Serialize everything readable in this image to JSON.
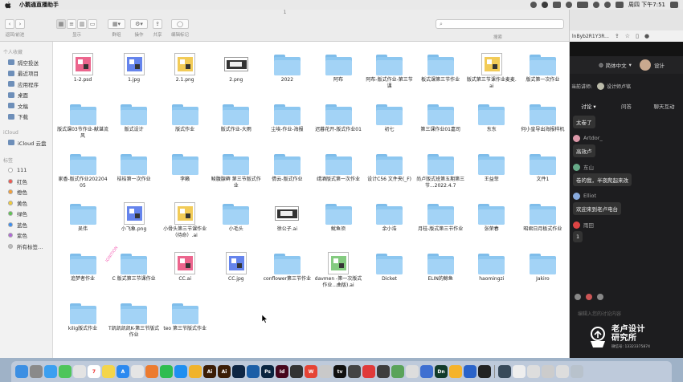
{
  "menubar": {
    "app_name": "小鹅通直播助手",
    "clock": "周四 下午7:51"
  },
  "finder": {
    "title": "1",
    "toolbar": {
      "nav_label": "返回/前进",
      "view_label": "显示",
      "group_label": "群组",
      "action_label": "操作",
      "share_label": "共享",
      "tags_label": "编辑标记",
      "search_label": "搜索"
    },
    "sidebar": {
      "favorites_head": "个人收藏",
      "favorites": [
        {
          "label": "隔空投送",
          "icon": "airdrop-icon"
        },
        {
          "label": "最近项目",
          "icon": "clock-icon"
        },
        {
          "label": "应用程序",
          "icon": "apps-icon"
        },
        {
          "label": "桌面",
          "icon": "desktop-icon"
        },
        {
          "label": "文稿",
          "icon": "document-icon"
        },
        {
          "label": "下载",
          "icon": "download-icon"
        }
      ],
      "icloud_head": "iCloud",
      "icloud": [
        {
          "label": "iCloud 云盘",
          "icon": "cloud-icon"
        }
      ],
      "tags_head": "标签",
      "tags": [
        {
          "label": "111",
          "color": "#ffffff"
        },
        {
          "label": "红色",
          "color": "#ee5a52"
        },
        {
          "label": "橙色",
          "color": "#f4a03a"
        },
        {
          "label": "黄色",
          "color": "#f1cc3b"
        },
        {
          "label": "绿色",
          "color": "#5fc454"
        },
        {
          "label": "蓝色",
          "color": "#3d8ff0"
        },
        {
          "label": "紫色",
          "color": "#b06ad6"
        },
        {
          "label": "所有标签…",
          "color": "#bdbdbd"
        }
      ]
    },
    "files": [
      {
        "name": "1-2.psd",
        "kind": "image"
      },
      {
        "name": "1.jpg",
        "kind": "image"
      },
      {
        "name": "2.1.png",
        "kind": "image"
      },
      {
        "name": "2.png",
        "kind": "wide"
      },
      {
        "name": "2022",
        "kind": "folder"
      },
      {
        "name": "阿布",
        "kind": "folder"
      },
      {
        "name": "阿布-版式作业-第三节课",
        "kind": "folder"
      },
      {
        "name": "板式课第三节作业",
        "kind": "folder"
      },
      {
        "name": "版式第三节课作业麦麦.ai",
        "kind": "image"
      },
      {
        "name": "版式第一次作业",
        "kind": "folder"
      },
      {
        "name": "版式课03节作业-献谌流风",
        "kind": "folder"
      },
      {
        "name": "版式设计",
        "kind": "folder"
      },
      {
        "name": "版式作业",
        "kind": "folder"
      },
      {
        "name": "版式作业-大雨",
        "kind": "folder"
      },
      {
        "name": "尘埃-作业-海报",
        "kind": "folder"
      },
      {
        "name": "迟暮花开-版式作业01",
        "kind": "folder"
      },
      {
        "name": "初七",
        "kind": "folder"
      },
      {
        "name": "第三课作业01嘉司",
        "kind": "folder"
      },
      {
        "name": "东东",
        "kind": "folder"
      },
      {
        "name": "何小皇导出海报样机",
        "kind": "folder"
      },
      {
        "name": "家香-版式作业20220405",
        "kind": "folder"
      },
      {
        "name": "桔桔第一次作业",
        "kind": "folder"
      },
      {
        "name": "李籁",
        "kind": "folder"
      },
      {
        "name": "鲮腹腺藓 第三节版式作业",
        "kind": "folder"
      },
      {
        "name": "倩云-版式作业",
        "kind": "folder"
      },
      {
        "name": "靖酒版式第一次作业",
        "kind": "folder"
      },
      {
        "name": "设计C56 文件夹(_F)",
        "kind": "folder"
      },
      {
        "name": "尚卢版式班第五期第三节...2022.4.7",
        "kind": "folder"
      },
      {
        "name": "王益菲",
        "kind": "folder"
      },
      {
        "name": "文件1",
        "kind": "folder"
      },
      {
        "name": "吴伟",
        "kind": "folder"
      },
      {
        "name": "小飞象.png",
        "kind": "image"
      },
      {
        "name": "小骨头第三节课作业（待命）.ai",
        "kind": "image"
      },
      {
        "name": "小毛头",
        "kind": "folder"
      },
      {
        "name": "徐公子.ai",
        "kind": "wide"
      },
      {
        "name": "鱿鱼须",
        "kind": "folder"
      },
      {
        "name": "余小浩",
        "kind": "folder"
      },
      {
        "name": "月桂-版式第三节作业",
        "kind": "folder"
      },
      {
        "name": "张荣春",
        "kind": "folder"
      },
      {
        "name": "昭君日月板式作业",
        "kind": "folder"
      },
      {
        "name": "追梦者作业",
        "kind": "folder"
      },
      {
        "name": "C 版式第三节课作业",
        "kind": "folder"
      },
      {
        "name": "CC.ai",
        "kind": "image"
      },
      {
        "name": "CC.jpg",
        "kind": "image"
      },
      {
        "name": "conflower第三节作业",
        "kind": "folder"
      },
      {
        "name": "davmen -第一次版式作业...曲版).ai",
        "kind": "image"
      },
      {
        "name": "Dicket",
        "kind": "folder"
      },
      {
        "name": "ELIN的鲸鱼",
        "kind": "folder"
      },
      {
        "name": "haomingzi",
        "kind": "folder"
      },
      {
        "name": "Jakiro",
        "kind": "folder"
      },
      {
        "name": "kilig版式作业",
        "kind": "folder"
      },
      {
        "name": "T凯凯凯凯K-第三节版式作业",
        "kind": "folder"
      },
      {
        "name": "teo 第三节版式作业",
        "kind": "folder"
      }
    ]
  },
  "browser": {
    "url_fragment": "lnByb2R1Y3R...",
    "language": "简体中文",
    "presenter_prefix": "当前讲师:",
    "presenter_name": "设计师卢铭",
    "header_right": "设计"
  },
  "chat": {
    "tabs": [
      "讨论",
      "问答",
      "聊天互动"
    ],
    "messages": [
      {
        "user": "",
        "text": "太卷了"
      },
      {
        "user": "Artdor_",
        "text": "高效卢"
      },
      {
        "user": "东山",
        "text": "卷的我，半夜爬起来改"
      },
      {
        "user": "Elliot",
        "text": "欢迎来到老卢电台"
      },
      {
        "user": "雨田",
        "text": "1"
      }
    ],
    "input_placeholder": "编辑入您的讨论内容"
  },
  "brand": {
    "name_line1": "老卢设计",
    "name_line2": "研究所",
    "wechat": "微信号: 13323375874"
  },
  "dock": {
    "apps": [
      {
        "name": "finder-icon",
        "color": "#3c8fe3",
        "text": ""
      },
      {
        "name": "launchpad-icon",
        "color": "#8a8a8a",
        "text": ""
      },
      {
        "name": "safari-icon",
        "color": "#3b9ff0",
        "text": ""
      },
      {
        "name": "messages-icon",
        "color": "#4ec55a",
        "text": ""
      },
      {
        "name": "photos-icon",
        "color": "#e3e3e3",
        "text": ""
      },
      {
        "name": "calendar-icon",
        "color": "#ffffff",
        "text": "7"
      },
      {
        "name": "notes-icon",
        "color": "#f4d54b",
        "text": ""
      },
      {
        "name": "appstore-icon",
        "color": "#2b89f0",
        "text": "A"
      },
      {
        "name": "chrome-icon",
        "color": "#e5e5e5",
        "text": ""
      },
      {
        "name": "browser-icon",
        "color": "#ec7b2f",
        "text": ""
      },
      {
        "name": "wechat-icon",
        "color": "#2fbd4f",
        "text": ""
      },
      {
        "name": "qq-icon",
        "color": "#1f8ff0",
        "text": ""
      },
      {
        "name": "qq-browser-icon",
        "color": "#f1b32b",
        "text": ""
      },
      {
        "name": "illustrator-icon",
        "color": "#3b1d06",
        "text": "Ai"
      },
      {
        "name": "illustrator2-icon",
        "color": "#3b1d06",
        "text": "Ai"
      },
      {
        "name": "app-icon",
        "color": "#0e2644",
        "text": ""
      },
      {
        "name": "app2-icon",
        "color": "#1b5ea6",
        "text": ""
      },
      {
        "name": "photoshop-icon",
        "color": "#0a2540",
        "text": "Ps"
      },
      {
        "name": "indesign-icon",
        "color": "#46061c",
        "text": "Id"
      },
      {
        "name": "app3-icon",
        "color": "#333333",
        "text": ""
      },
      {
        "name": "wps-icon",
        "color": "#e54335",
        "text": "W"
      },
      {
        "name": "send-icon",
        "color": "#c9c9c9",
        "text": ""
      },
      {
        "name": "tv-icon",
        "color": "#111111",
        "text": "tv"
      },
      {
        "name": "app4-icon",
        "color": "#444444",
        "text": ""
      },
      {
        "name": "netease-icon",
        "color": "#e03a3a",
        "text": ""
      },
      {
        "name": "app5-icon",
        "color": "#3d3d3d",
        "text": ""
      },
      {
        "name": "app6-icon",
        "color": "#5aa35a",
        "text": ""
      },
      {
        "name": "chrome2-icon",
        "color": "#dddddd",
        "text": ""
      },
      {
        "name": "app7-icon",
        "color": "#3e6fd1",
        "text": ""
      },
      {
        "name": "dimension-icon",
        "color": "#123b2a",
        "text": "Dn"
      },
      {
        "name": "sketch-icon",
        "color": "#f5b32b",
        "text": ""
      },
      {
        "name": "app8-icon",
        "color": "#2a63c9",
        "text": ""
      },
      {
        "name": "terminal-icon",
        "color": "#222222",
        "text": ""
      },
      {
        "name": "app9-icon",
        "color": "#384a5a",
        "text": ""
      },
      {
        "name": "window-icon",
        "color": "#eeeeee",
        "text": ""
      },
      {
        "name": "window2-icon",
        "color": "#dddddd",
        "text": ""
      },
      {
        "name": "window3-icon",
        "color": "#cccccc",
        "text": ""
      },
      {
        "name": "window4-icon",
        "color": "#dddddd",
        "text": ""
      },
      {
        "name": "trash-icon",
        "color": "#b8c2cc",
        "text": ""
      }
    ]
  }
}
